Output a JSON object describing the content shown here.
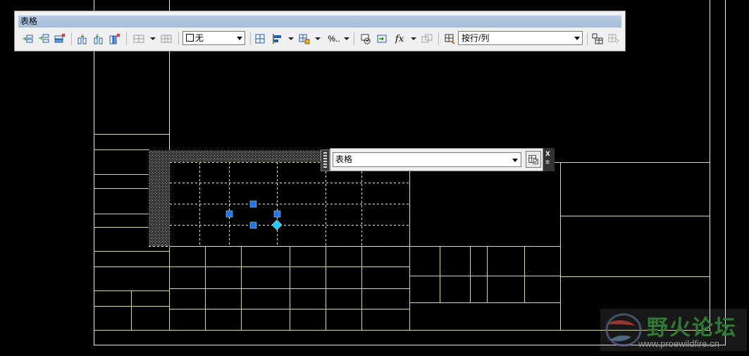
{
  "toolbar": {
    "title": "表格",
    "cell_border_combo": {
      "value": "无"
    },
    "percent_label": "%..",
    "fx_label": "fx",
    "match_combo": {
      "value": "按行/列"
    },
    "icons": [
      "insert-row-above-icon",
      "insert-row-below-icon",
      "delete-rows-icon",
      "insert-column-left-icon",
      "insert-column-right-icon",
      "delete-columns-icon",
      "merge-cells-icon",
      "unmerge-cells-icon",
      "cell-borders-icon",
      "alignment-icon",
      "cell-locking-icon",
      "data-format-icon",
      "insert-block-icon",
      "insert-field-icon",
      "insert-formula-icon",
      "manage-cell-content-icon",
      "match-cell-icon",
      "link-cell-icon",
      "download-changes-icon"
    ]
  },
  "mini_toolbar": {
    "combo_value": "表格",
    "close_label": "x",
    "menu_label": "≡"
  },
  "watermark": {
    "title": "野火论坛",
    "url": "www.proewildfire.cn"
  },
  "colors": {
    "background": "#000000",
    "table_lines": "#d8d6a2",
    "selection_grip": "#1e78e0",
    "toolbar_bg": "#f0f0f0",
    "toolbar_title_bg": "#a9bfdb",
    "watermark_green": "#2f7a34"
  }
}
